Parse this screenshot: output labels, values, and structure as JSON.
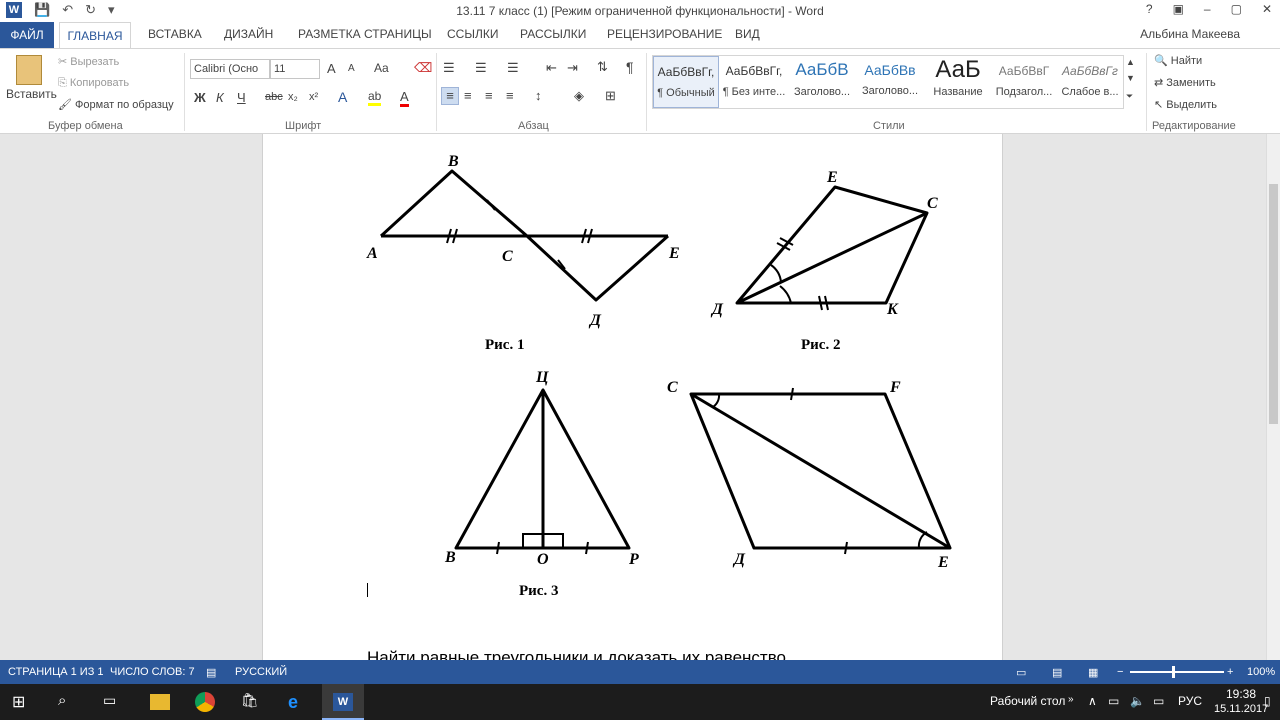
{
  "window": {
    "title": "13.11 7 класс (1) [Режим ограниченной функциональности] - Word",
    "buttons": [
      "?",
      "▣",
      "–",
      "▢",
      "✕"
    ]
  },
  "qat": {
    "app_icon": "W",
    "save": "💾",
    "undo": "↶",
    "redo": "↻",
    "more": "▾"
  },
  "tabs": [
    "ФАЙЛ",
    "ГЛАВНАЯ",
    "ВСТАВКА",
    "ДИЗАЙН",
    "РАЗМЕТКА СТРАНИЦЫ",
    "ССЫЛКИ",
    "РАССЫЛКИ",
    "РЕЦЕНЗИРОВАНИЕ",
    "ВИД"
  ],
  "user": "Альбина Макеева",
  "clipboard": {
    "paste": "Вставить",
    "cut": "Вырезать",
    "copy": "Копировать",
    "format": "Формат по образцу",
    "label": "Буфер обмена"
  },
  "font": {
    "name": "Calibri (Осно",
    "size": "11",
    "label": "Шрифт",
    "bold": "Ж",
    "italic": "К",
    "underline": "Ч",
    "strike": "abc",
    "sub": "x₂",
    "sup": "x²",
    "grow": "A",
    "shrink": "A",
    "case": "Aa"
  },
  "paragraph": {
    "label": "Абзац",
    "pilcrow": "¶"
  },
  "styles": {
    "label": "Стили",
    "items": [
      {
        "sample": "АаБбВвГг,",
        "name": "¶ Обычный"
      },
      {
        "sample": "АаБбВвГг,",
        "name": "¶ Без инте..."
      },
      {
        "sample": "АаБбВ",
        "name": "Заголово..."
      },
      {
        "sample": "АаБбВв",
        "name": "Заголово..."
      },
      {
        "sample": "АаБ",
        "name": "Название"
      },
      {
        "sample": "АаБбВвГ",
        "name": "Подзагол..."
      },
      {
        "sample": "АаБбВвГг",
        "name": "Слабое в..."
      }
    ]
  },
  "editing": {
    "label": "Редактирование",
    "find": "Найти",
    "replace": "Заменить",
    "select": "Выделить"
  },
  "figures": {
    "fig1": {
      "caption": "Рис. 1",
      "A": "A",
      "B": "B",
      "C": "C",
      "D": "Д",
      "E": "E"
    },
    "fig2": {
      "caption": "Рис. 2",
      "E": "E",
      "C": "C",
      "D": "Д",
      "K": "K"
    },
    "fig3": {
      "caption": "Рис. 3",
      "Ts": "Ц",
      "B": "B",
      "O": "O",
      "P": "P"
    },
    "fig4": {
      "C": "C",
      "F": "F",
      "D": "Д",
      "E": "E"
    }
  },
  "document": {
    "text": "Найти равные треугольники и доказать их равенство"
  },
  "status": {
    "page": "СТРАНИЦА 1 ИЗ 1",
    "words": "ЧИСЛО СЛОВ: 7",
    "lang": "РУССКИЙ",
    "zoom": "100%"
  },
  "taskbar": {
    "desktop": "Рабочий стол",
    "lang": "РУС",
    "time": "19:38",
    "date": "15.11.2017"
  },
  "colors": {
    "accent": "#2b579a",
    "taskbar": "#1c1c1c"
  }
}
